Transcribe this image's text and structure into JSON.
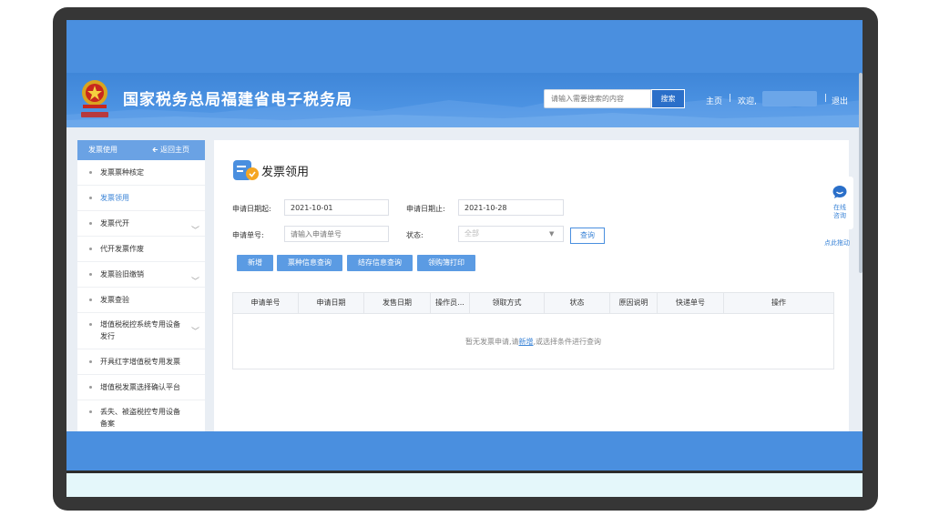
{
  "header": {
    "site_title": "国家税务总局福建省电子税务局",
    "search_placeholder": "请输入需要搜索的内容",
    "search_button": "搜索",
    "nav_home": "主页",
    "nav_welcome": "欢迎,",
    "nav_logout": "退出"
  },
  "sidebar": {
    "section_title": "发票使用",
    "back_label": "返回主页",
    "items": [
      {
        "label": "发票票种核定"
      },
      {
        "label": "发票领用"
      },
      {
        "label": "发票代开"
      },
      {
        "label": "代开发票作废"
      },
      {
        "label": "发票验旧缴销"
      },
      {
        "label": "发票查验"
      },
      {
        "label": "增值税税控系统专用设备发行"
      },
      {
        "label": "开具红字增值税专用发票"
      },
      {
        "label": "增值税发票选择确认平台"
      },
      {
        "label": "丢失、被盗税控专用设备备案"
      }
    ]
  },
  "main": {
    "page_title": "发票领用",
    "form": {
      "start_date_label": "申请日期起:",
      "start_date_value": "2021-10-01",
      "end_date_label": "申请日期止:",
      "end_date_value": "2021-10-28",
      "app_no_label": "申请单号:",
      "app_no_placeholder": "请输入申请单号",
      "status_label": "状态:",
      "status_value": "全部",
      "query_button": "查询"
    },
    "actions": [
      "新增",
      "票种信息查询",
      "结存信息查询",
      "领购簿打印"
    ],
    "table": {
      "columns": [
        "申请单号",
        "申请日期",
        "发售日期",
        "操作员...",
        "领取方式",
        "状态",
        "原因说明",
        "快递单号",
        "操作"
      ],
      "empty_prefix": "暂无发票申请,请",
      "empty_link": "新增",
      "empty_suffix": ",或选择条件进行查询"
    }
  },
  "float_widget": {
    "chat_label_1": "在线",
    "chat_label_2": "咨询",
    "drag_label": "点此拖动"
  },
  "colors": {
    "brand_blue": "#4a8fdf",
    "button_blue": "#5b9be3",
    "link_blue": "#3b84d7"
  }
}
